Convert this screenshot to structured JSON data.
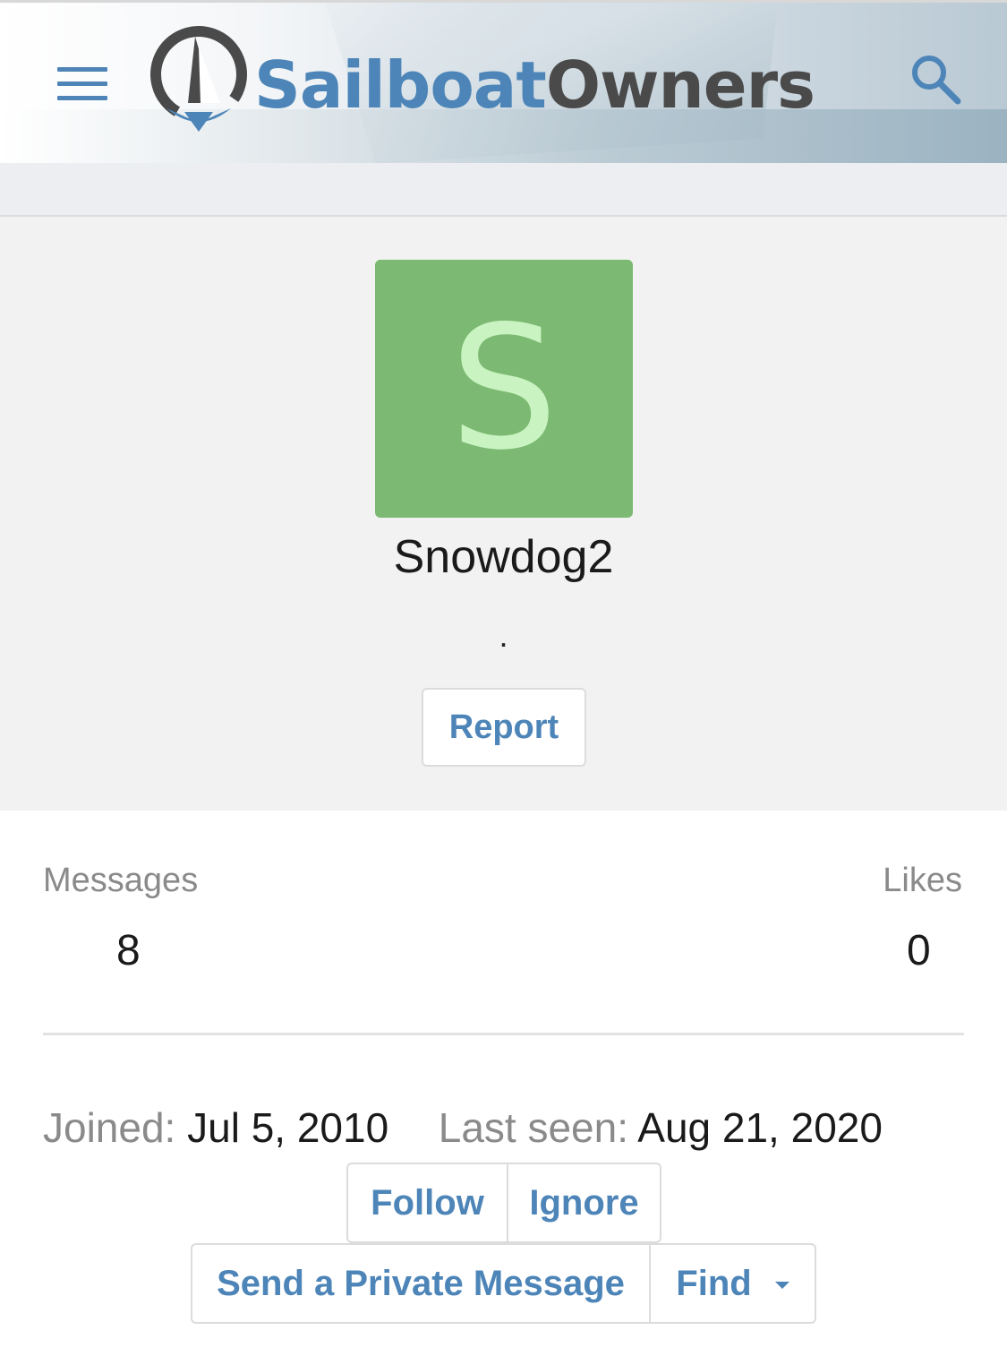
{
  "header": {
    "logo": {
      "part1": "Sailboat",
      "part2": "Owners"
    },
    "menu_icon": "hamburger-menu-icon",
    "search_icon": "search-icon"
  },
  "profile": {
    "avatar_letter": "S",
    "avatar_color": "#7cb972",
    "username": "Snowdog2",
    "user_title": ".",
    "report_label": "Report"
  },
  "stats": {
    "messages_label": "Messages",
    "messages_value": "8",
    "likes_label": "Likes",
    "likes_value": "0"
  },
  "info": {
    "joined_label": "Joined:",
    "joined_value": "Jul 5, 2010",
    "last_seen_label": "Last seen:",
    "last_seen_value": "Aug 21, 2020"
  },
  "actions": {
    "follow": "Follow",
    "ignore": "Ignore",
    "private_message": "Send a Private Message",
    "find": "Find"
  },
  "colors": {
    "accent": "#4d85b8",
    "logo_dark": "#4a4a4a"
  }
}
